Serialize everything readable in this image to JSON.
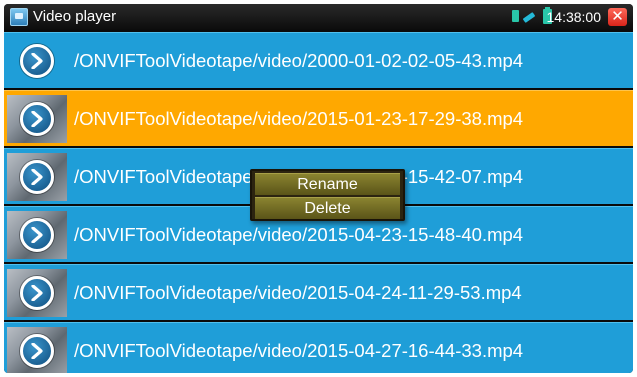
{
  "window": {
    "title": "Video player",
    "time": "14:38:00",
    "close_symbol": "✕"
  },
  "icons": {
    "app": "video-player-app-icon",
    "sim": "sim-icon",
    "network": "network-icon",
    "battery": "battery-icon",
    "close": "close-icon",
    "play": "play-circle-icon"
  },
  "colors": {
    "row_bg": "#1f9ed8",
    "row_selected_bg": "#ffa800",
    "menu_item_bg": "#6f6a24",
    "close_bg": "#e03024"
  },
  "files": [
    {
      "name": "/ONVIFToolVideotape/video/2000-01-02-02-05-43.mp4",
      "has_thumbnail": false,
      "selected": false
    },
    {
      "name": "/ONVIFToolVideotape/video/2015-01-23-17-29-38.mp4",
      "has_thumbnail": true,
      "selected": true
    },
    {
      "name": "/ONVIFToolVideotape/video/2015-04-23-15-42-07.mp4",
      "has_thumbnail": true,
      "selected": false
    },
    {
      "name": "/ONVIFToolVideotape/video/2015-04-23-15-48-40.mp4",
      "has_thumbnail": true,
      "selected": false
    },
    {
      "name": "/ONVIFToolVideotape/video/2015-04-24-11-29-53.mp4",
      "has_thumbnail": true,
      "selected": false
    },
    {
      "name": "/ONVIFToolVideotape/video/2015-04-27-16-44-33.mp4",
      "has_thumbnail": true,
      "selected": false
    }
  ],
  "context_menu": {
    "items": [
      {
        "label": "Rename"
      },
      {
        "label": "Delete"
      }
    ]
  }
}
